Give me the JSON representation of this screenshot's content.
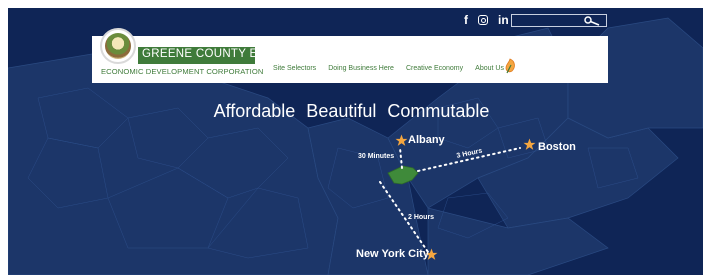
{
  "social": {
    "facebook_label": "f",
    "instagram_icon": "instagram-icon",
    "linkedin_label": "in"
  },
  "search": {
    "value": "",
    "placeholder": "",
    "icon": "key-search-icon"
  },
  "logo": {
    "title": "GREENE COUNTY E.D.C.",
    "subtitle": "ECONOMIC DEVELOPMENT CORPORATION",
    "seal_icon": "county-seal"
  },
  "nav": {
    "items": [
      {
        "label": "Site Selectors"
      },
      {
        "label": "Doing Business Here"
      },
      {
        "label": "Creative Economy"
      },
      {
        "label": "About Us"
      }
    ],
    "leaf_icon": "leaf-icon"
  },
  "hero": {
    "headline": "Affordable Beautiful Commutable"
  },
  "map": {
    "cities": {
      "albany": "Albany",
      "boston": "Boston",
      "nyc": "New York City"
    },
    "distances": {
      "albany": "30 Minutes",
      "boston": "3 Hours",
      "nyc": "2 Hours"
    },
    "colors": {
      "background": "#0f2556",
      "county": "#3f8a3a",
      "star": "#f4a640",
      "brand_green": "#3f7b3a"
    }
  }
}
